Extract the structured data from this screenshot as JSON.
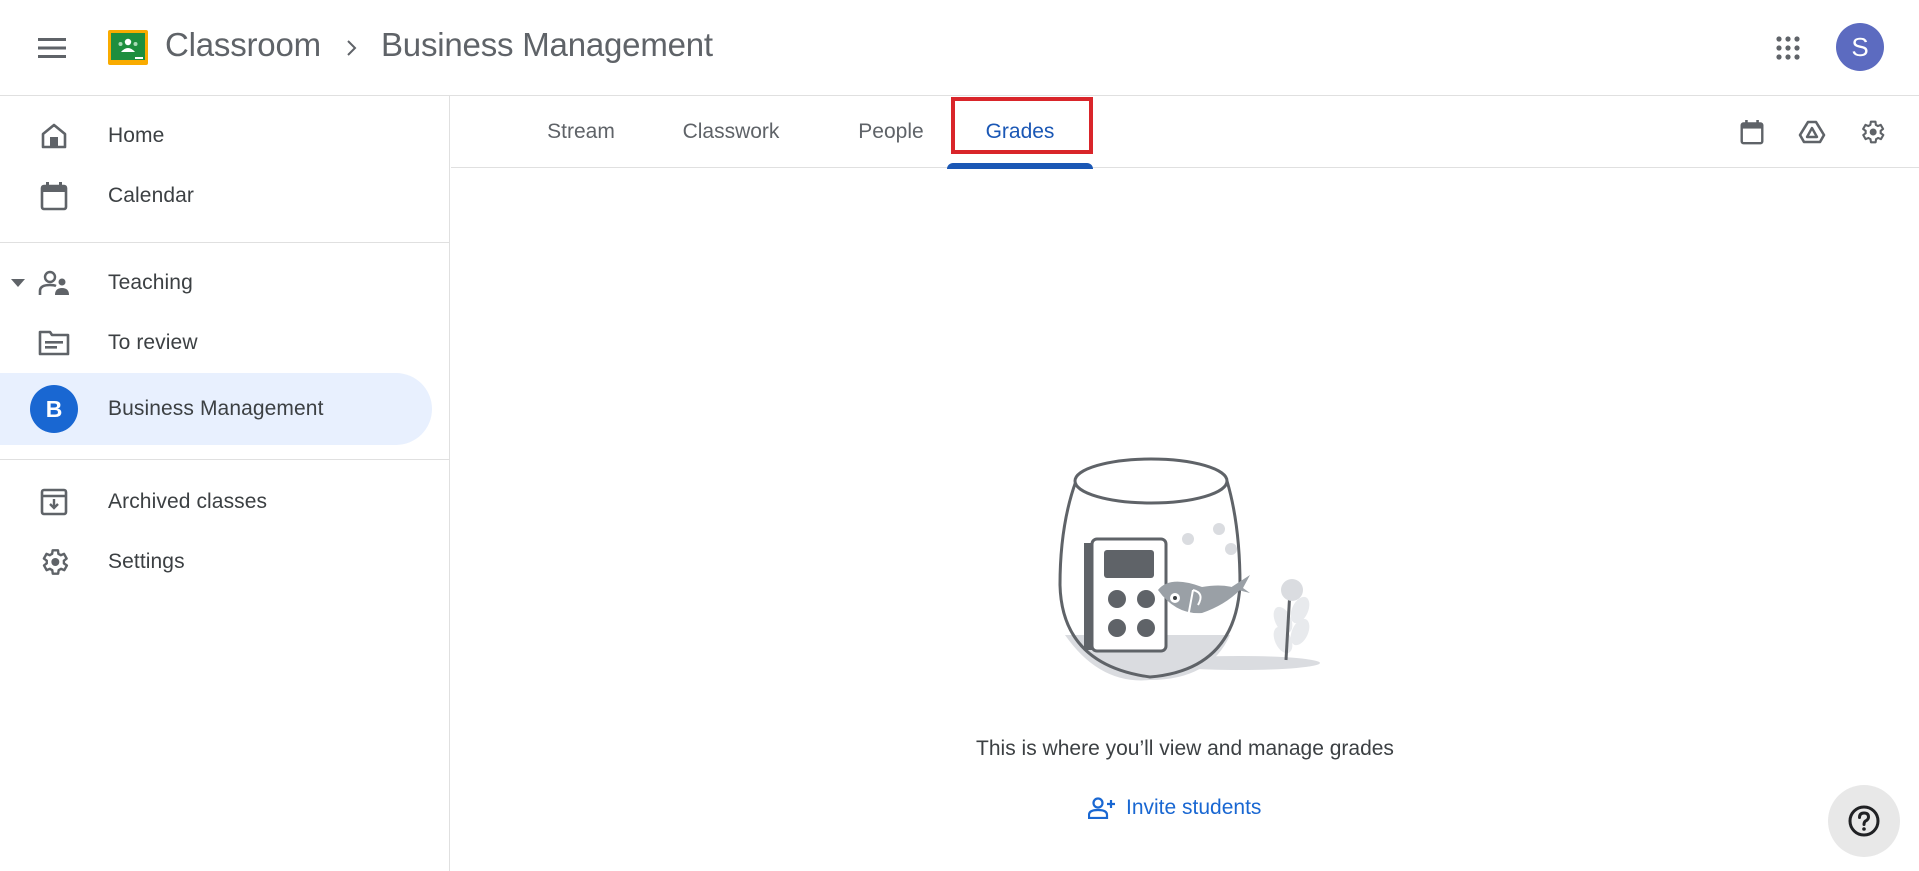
{
  "header": {
    "menu_icon": "hamburger-menu-icon",
    "app_name": "Classroom",
    "breadcrumb_separator_icon": "chevron-right-icon",
    "class_name": "Business Management",
    "apps_icon": "google-apps-grid-icon",
    "account_initial": "S",
    "colors": {
      "avatar": "#5c6bc0",
      "logo_green": "#1e8e3e",
      "logo_yellow": "#f9ab00"
    }
  },
  "sidebar": {
    "items": [
      {
        "label": "Home",
        "icon": "home-icon"
      },
      {
        "label": "Calendar",
        "icon": "calendar-icon"
      },
      {
        "label": "Teaching",
        "icon": "teaching-people-icon",
        "expanded": true
      },
      {
        "label": "To review",
        "icon": "to-review-folder-icon"
      },
      {
        "label": "Business Management",
        "avatar_initial": "B",
        "active": true
      },
      {
        "label": "Archived classes",
        "icon": "archive-icon"
      },
      {
        "label": "Settings",
        "icon": "settings-gear-icon"
      }
    ],
    "colors": {
      "active_bg": "#e8f0fe",
      "class_avatar": "#1967d2"
    }
  },
  "tabs": {
    "items": [
      {
        "label": "Stream"
      },
      {
        "label": "Classwork"
      },
      {
        "label": "People"
      },
      {
        "label": "Grades",
        "active": true
      }
    ],
    "tools": [
      "calendar-icon",
      "google-drive-icon",
      "class-settings-gear-icon"
    ],
    "colors": {
      "active": "#1a57b5",
      "highlight_box": "#d9252a"
    }
  },
  "main": {
    "empty_state_illustration": "fishbowl-calculator-illustration",
    "empty_message": "This is where you’ll view and manage grades",
    "invite_label": "Invite students",
    "invite_icon": "person-add-icon",
    "colors": {
      "link": "#1967d2"
    }
  },
  "help": {
    "icon": "help-question-icon"
  }
}
